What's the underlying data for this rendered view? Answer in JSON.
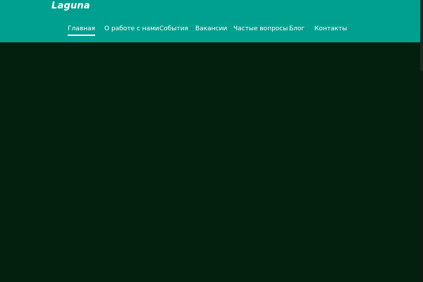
{
  "header": {
    "logo_text": "Laguna",
    "background_color": "#00a091"
  },
  "nav": {
    "items": [
      {
        "label": "Главная",
        "active": true
      },
      {
        "label": "О работе с нами",
        "active": false
      },
      {
        "label": "События",
        "active": false
      },
      {
        "label": "Вакансии",
        "active": false
      },
      {
        "label": "Частые вопросы",
        "active": false
      },
      {
        "label": "Блог",
        "active": false
      },
      {
        "label": "Контакты",
        "active": false
      }
    ]
  },
  "main": {
    "background_color": "#03200f"
  }
}
